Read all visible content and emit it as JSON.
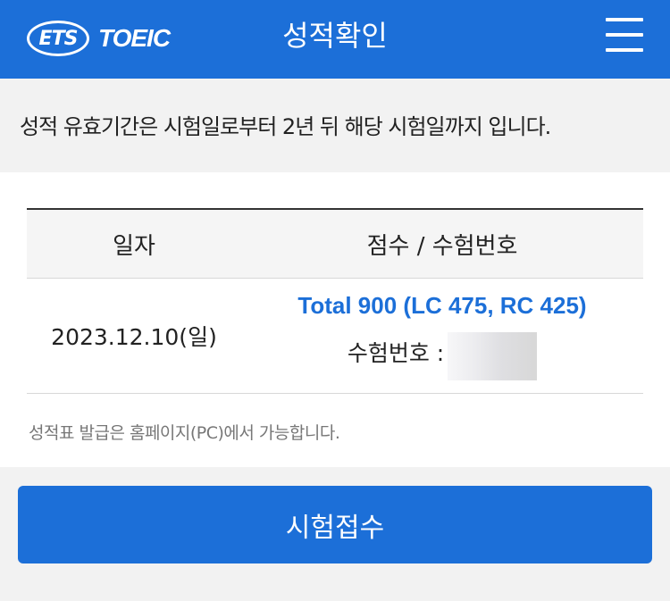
{
  "header": {
    "logo_ets": "ETS",
    "logo_toeic": "TOEIC",
    "title": "성적확인"
  },
  "notice": "성적 유효기간은 시험일로부터 2년 뒤 해당 시험일까지 입니다.",
  "table": {
    "columns": [
      "일자",
      "점수 / 수험번호"
    ],
    "rows": [
      {
        "date": "2023.12.10(일)",
        "score": "Total 900 (LC 475, RC 425)",
        "exam_number_label": "수험번호 :"
      }
    ]
  },
  "print_notice": "성적표 발급은 홈페이지(PC)에서 가능합니다.",
  "apply_button": "시험접수",
  "colors": {
    "brand_blue": "#1c6fd8",
    "background_gray": "#f2f2f2"
  }
}
